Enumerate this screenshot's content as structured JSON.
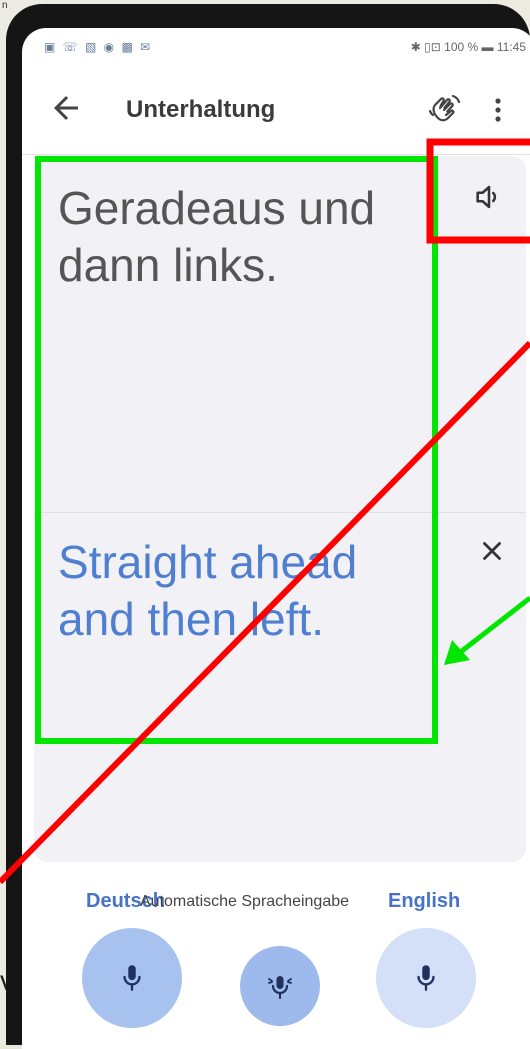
{
  "corner_text": "n",
  "side_text": "v",
  "statusbar": {
    "left_icons": "▣ ☏ ▧ ◉ ▩ ✉",
    "right": "✱ ▯⊡ 100 % ▬ 11:45"
  },
  "appbar": {
    "title": "Unterhaltung"
  },
  "conversation": {
    "source_text": "Geradeaus und dann links.",
    "target_text": "Straight ahead and then left."
  },
  "languages": {
    "left": "Deutsch",
    "auto": "Automatische Spracheingabe",
    "right": "English"
  },
  "colors": {
    "accent_blue": "#4673c9",
    "annotation_green": "#00e600",
    "annotation_red": "#ff0000"
  },
  "icons": [
    "back-arrow-icon",
    "wave-hand-icon",
    "more-vert-icon",
    "speaker-icon",
    "close-icon",
    "mic-icon",
    "auto-mic-icon"
  ]
}
